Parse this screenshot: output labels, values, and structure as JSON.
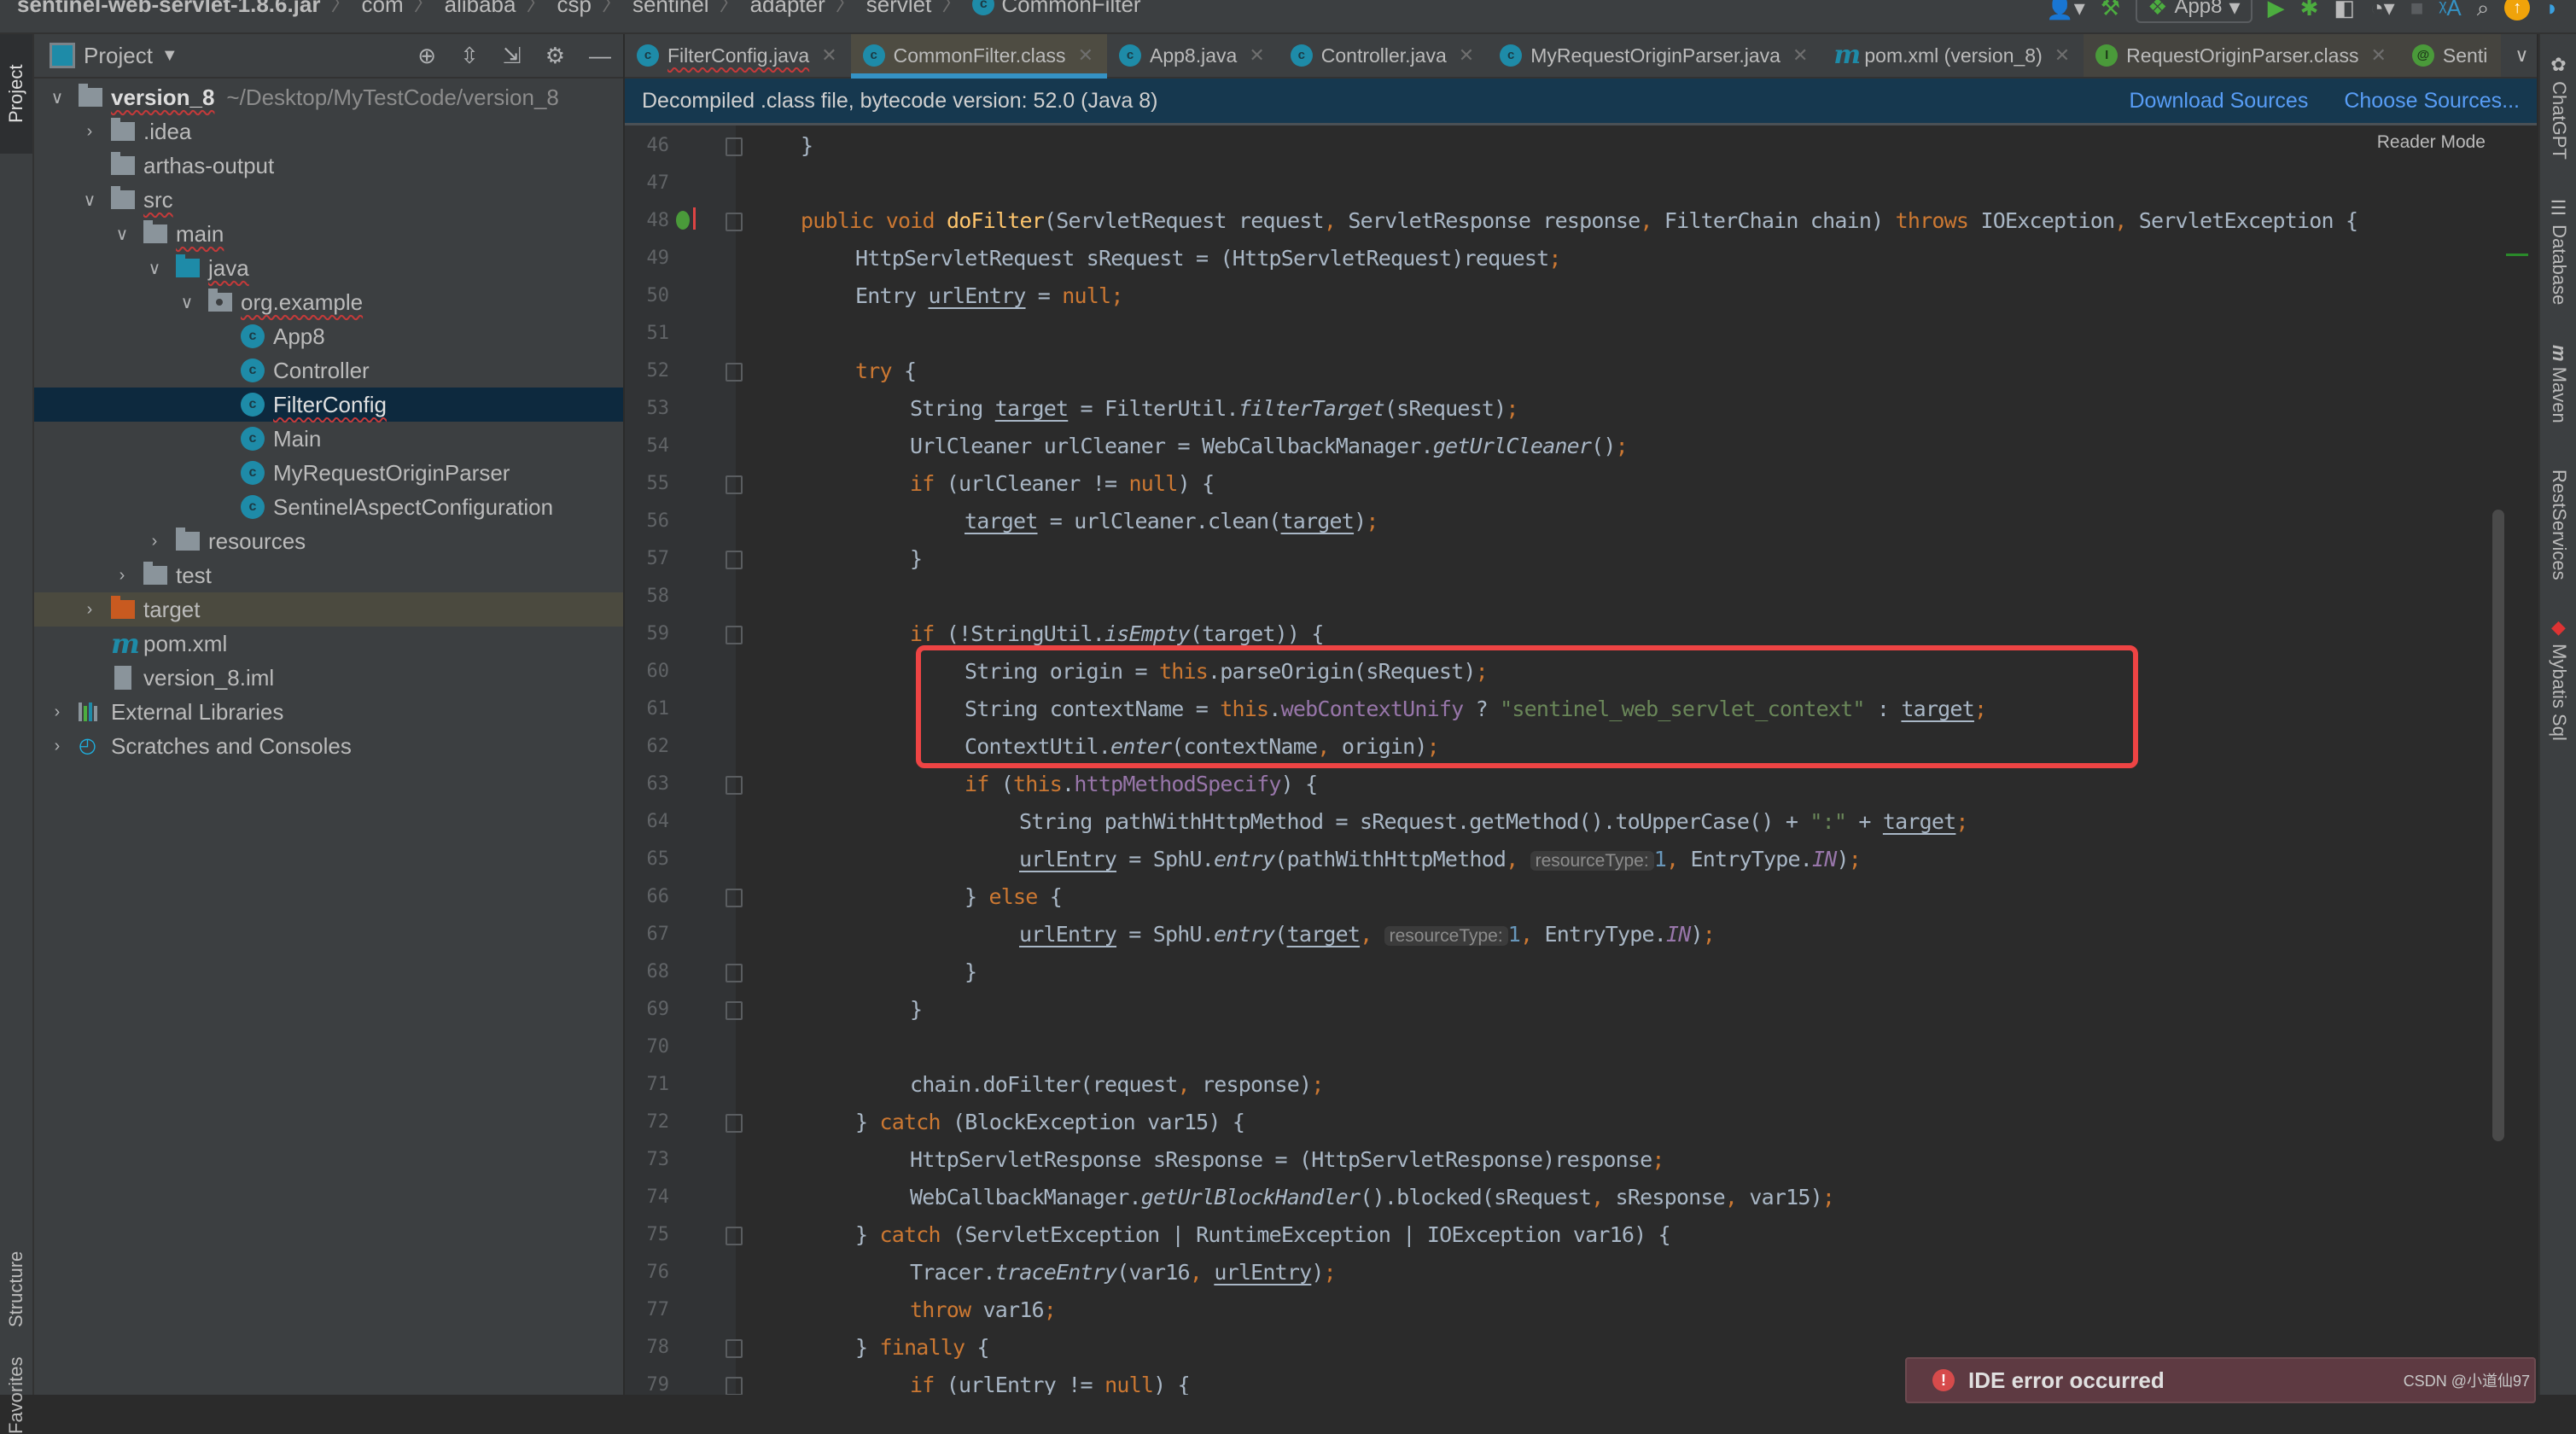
{
  "navbar": {
    "breadcrumbs": [
      "sentinel-web-servlet-1.8.6.jar",
      "com",
      "alibaba",
      "csp",
      "sentinel",
      "adapter",
      "servlet",
      "CommonFilter"
    ],
    "run_config": "App8"
  },
  "left_strip": {
    "project": "Project",
    "structure": "Structure",
    "favorites": "Favorites"
  },
  "project_panel": {
    "title": "Project",
    "tree": [
      {
        "label": "version_8",
        "path": "~/Desktop/MyTestCode/version_8",
        "depth": 0,
        "expanded": true,
        "icon": "module-folder-icon"
      },
      {
        "label": ".idea",
        "depth": 1,
        "expanded": false,
        "icon": "folder-icon"
      },
      {
        "label": "arthas-output",
        "depth": 1,
        "icon": "folder-icon"
      },
      {
        "label": "src",
        "depth": 1,
        "expanded": true,
        "icon": "folder-icon"
      },
      {
        "label": "main",
        "depth": 2,
        "expanded": true,
        "icon": "folder-icon"
      },
      {
        "label": "java",
        "depth": 3,
        "expanded": true,
        "icon": "source-folder-icon"
      },
      {
        "label": "org.example",
        "depth": 4,
        "expanded": true,
        "icon": "package-icon"
      },
      {
        "label": "App8",
        "depth": 5,
        "icon": "spring-boot-class-icon"
      },
      {
        "label": "Controller",
        "depth": 5,
        "icon": "class-icon"
      },
      {
        "label": "FilterConfig",
        "depth": 5,
        "icon": "class-icon",
        "selected": true
      },
      {
        "label": "Main",
        "depth": 5,
        "icon": "runnable-class-icon"
      },
      {
        "label": "MyRequestOriginParser",
        "depth": 5,
        "icon": "class-icon"
      },
      {
        "label": "SentinelAspectConfiguration",
        "depth": 5,
        "icon": "class-icon"
      },
      {
        "label": "resources",
        "depth": 3,
        "expanded": false,
        "icon": "resources-folder-icon"
      },
      {
        "label": "test",
        "depth": 2,
        "expanded": false,
        "icon": "folder-icon"
      },
      {
        "label": "target",
        "depth": 1,
        "expanded": false,
        "icon": "excluded-folder-icon"
      },
      {
        "label": "pom.xml",
        "depth": 1,
        "icon": "maven-icon"
      },
      {
        "label": "version_8.iml",
        "depth": 1,
        "icon": "iml-file-icon"
      },
      {
        "label": "External Libraries",
        "depth": 0,
        "expanded": false,
        "icon": "libraries-icon"
      },
      {
        "label": "Scratches and Consoles",
        "depth": 0,
        "expanded": false,
        "icon": "scratches-icon"
      }
    ]
  },
  "tabs": [
    {
      "label": "FilterConfig.java",
      "icon": "class-icon"
    },
    {
      "label": "CommonFilter.class",
      "icon": "class-locked-icon",
      "active": true
    },
    {
      "label": "App8.java",
      "icon": "spring-boot-class-icon"
    },
    {
      "label": "Controller.java",
      "icon": "class-icon"
    },
    {
      "label": "MyRequestOriginParser.java",
      "icon": "class-icon"
    },
    {
      "label": "pom.xml (version_8)",
      "icon": "maven-icon"
    },
    {
      "label": "RequestOriginParser.class",
      "icon": "interface-locked-icon"
    },
    {
      "label": "Senti",
      "icon": "annotation-icon"
    }
  ],
  "banner": {
    "text": "Decompiled .class file, bytecode version: 52.0 (Java 8)",
    "download_sources": "Download Sources",
    "choose_sources": "Choose Sources..."
  },
  "editor": {
    "reader_mode": "Reader Mode",
    "line_numbers": [
      "46",
      "47",
      "48",
      "49",
      "50",
      "51",
      "52",
      "53",
      "54",
      "55",
      "56",
      "57",
      "58",
      "59",
      "60",
      "61",
      "62",
      "63",
      "64",
      "65",
      "66",
      "67",
      "68",
      "69",
      "70",
      "71",
      "72",
      "73",
      "74",
      "75",
      "76",
      "77",
      "78",
      "79"
    ],
    "code": {
      "l46": "}",
      "l48_kw": "public void ",
      "l48_fn": "doFilter",
      "l48_a": "(ServletRequest request",
      "l48_b": " ServletResponse response",
      "l48_c": " FilterChain chain) ",
      "l48_throws": "throws",
      "l48_d": " IOException",
      "l48_e": " ServletException {",
      "l49": "HttpServletRequest sRequest = (HttpServletRequest)request",
      "l50_a": "Entry ",
      "l50_var": "urlEntry",
      "l50_b": " = ",
      "l50_null": "null",
      "l52": "try",
      "l53_a": "String ",
      "l53_var": "target",
      "l53_b": " = FilterUtil.",
      "l53_m": "filterTarget",
      "l53_c": "(sRequest)",
      "l54_a": "UrlCleaner urlCleaner = WebCallbackManager.",
      "l54_m": "getUrlCleaner",
      "l54_b": "()",
      "l55_if": "if",
      "l55_a": " (urlCleaner != ",
      "l55_null": "null",
      "l55_b": ") {",
      "l56_var": "target",
      "l56_a": " = urlCleaner.clean(",
      "l56_b": ")",
      "l57": "}",
      "l59_if": "if",
      "l59_a": " (!StringUtil.",
      "l59_m": "isEmpty",
      "l59_b": "(",
      "l59_c": ")) {",
      "l60_a": "String origin = ",
      "l60_this": "this",
      "l60_b": ".parseOrigin(sRequest)",
      "l61_a": "String contextName = ",
      "l61_this": "this",
      "l61_dot": ".",
      "l61_fld": "webContextUnify",
      "l61_b": " ? ",
      "l61_str": "\"sentinel_web_servlet_context\"",
      "l61_c": " : ",
      "l62_a": "ContextUtil.",
      "l62_m": "enter",
      "l62_b": "(contextName",
      "l62_c": " origin)",
      "l63_if": "if",
      "l63_a": " (",
      "l63_this": "this",
      "l63_fld": "httpMethodSpecify",
      "l63_b": ") {",
      "l64_a": "String pathWithHttpMethod = sRequest.getMethod().toUpperCase() + ",
      "l64_str": "\":\"",
      "l64_b": " + ",
      "l65_a": " = SphU.",
      "l65_m": "entry",
      "l65_b": "(pathWithHttpMethod",
      "l65_hint": "resourceType:",
      "l65_num": "1",
      "l65_c": " EntryType.",
      "l65_in": "IN",
      "l66_a": "} ",
      "l66_else": "else",
      "l66_b": " {",
      "l67_b": "(",
      "l67_hint": "resourceType:",
      "l67_num": "1",
      "l68": "}",
      "l69": "}",
      "l71_a": "chain.doFilter(request",
      "l71_b": " response)",
      "l72_catch": "catch",
      "l72_a": " (BlockException var15) {",
      "l73": "HttpServletResponse sResponse = (HttpServletResponse)response",
      "l74_a": "WebCallbackManager.",
      "l74_m": "getUrlBlockHandler",
      "l74_b": "().blocked(sRequest",
      "l74_c": " sResponse",
      "l74_d": " var15)",
      "l75_a": " (ServletException | RuntimeException | IOException var16) {",
      "l76_a": "Tracer.",
      "l76_m": "traceEntry",
      "l76_b": "(var16",
      "l76_c": ")",
      "l77_throw": "throw",
      "l77_a": " var16",
      "l78_finally": "finally",
      "l79_a": " (",
      "l79_b": " != ",
      "l79_c": ") {",
      "brace_close": "}",
      "brace_open": " {",
      "comma": ",",
      "semi": ";",
      "space": " "
    }
  },
  "right_strip": [
    "ChatGPT",
    "Database",
    "Maven",
    "RestServices",
    "Mybatis Sql"
  ],
  "notification": {
    "title": "IDE error occurred"
  },
  "watermark": "CSDN @小道仙97",
  "colors": {
    "keyword": "#cc7832",
    "method_decl": "#ffc66d",
    "string": "#6a8759",
    "field": "#9876aa",
    "number": "#6897bb",
    "default_text": "#a9b7c6",
    "highlight_box": "#ee4444",
    "selection": "#0d293e",
    "banner_bg": "#16384f",
    "link": "#589df6"
  }
}
